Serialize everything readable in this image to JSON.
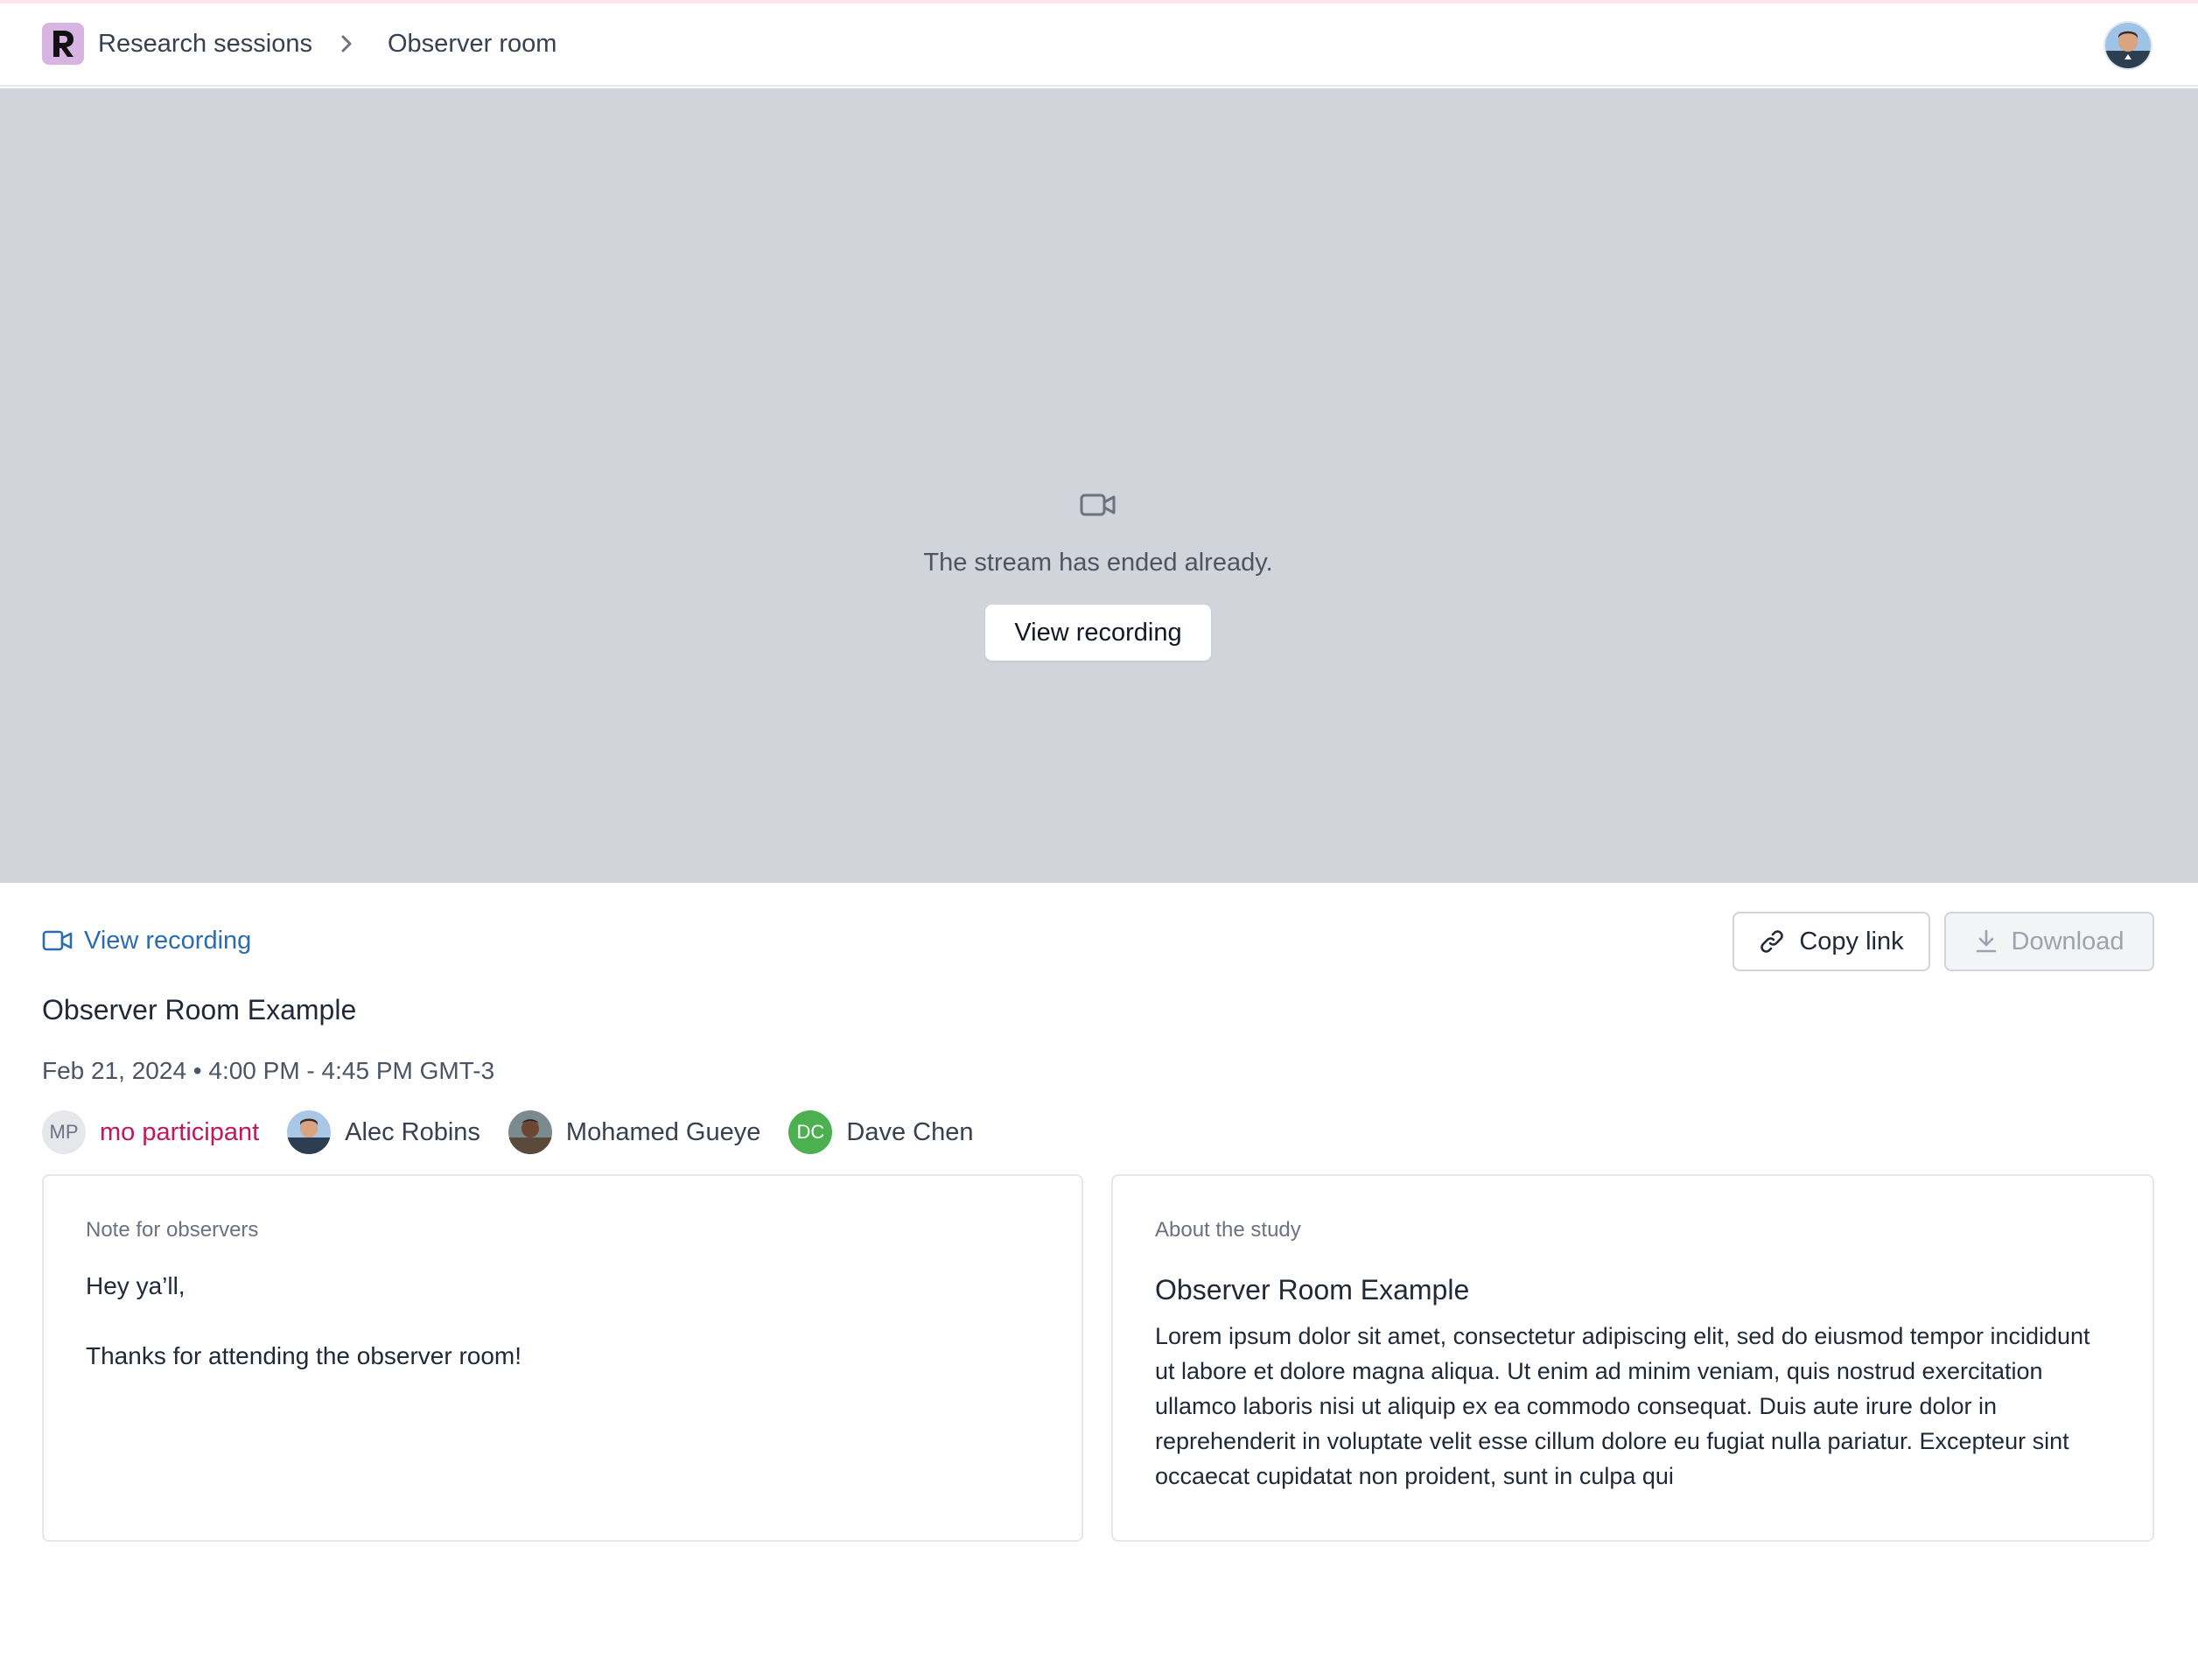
{
  "header": {
    "logo_letter": "R",
    "breadcrumb": [
      {
        "label": "Research sessions"
      },
      {
        "label": "Observer room"
      }
    ]
  },
  "stream": {
    "message": "The stream has ended already.",
    "button_label": "View recording"
  },
  "session": {
    "view_recording_link": "View recording",
    "copy_link_label": "Copy link",
    "download_label": "Download",
    "title": "Observer Room Example",
    "datetime": "Feb 21, 2024 • 4:00 PM - 4:45 PM GMT-3",
    "participants": [
      {
        "initials": "MP",
        "name": "mo participant",
        "highlight_color": "#c2185b"
      },
      {
        "name": "Alec Robins"
      },
      {
        "name": "Mohamed Gueye"
      },
      {
        "initials": "DC",
        "name": "Dave Chen",
        "avatar_color": "#4caf50"
      }
    ]
  },
  "note_card": {
    "label": "Note for observers",
    "lines": [
      "Hey ya’ll,",
      "Thanks for attending the observer room!"
    ]
  },
  "study_card": {
    "label": "About the study",
    "title": "Observer Room Example",
    "body": "Lorem ipsum dolor sit amet, consectetur adipiscing elit, sed do eiusmod tempor incididunt ut labore et dolore magna aliqua. Ut enim ad minim veniam, quis nostrud exercitation ullamco laboris nisi ut aliquip ex ea commodo consequat. Duis aute irure dolor in reprehenderit in voluptate velit esse cillum dolore eu fugiat nulla pariatur. Excepteur sint occaecat cupidatat non proident, sunt in culpa qui"
  },
  "colors": {
    "link": "#2b6cb0",
    "stream_bg": "#d1d5db",
    "logo_bg": "#d8b4e2"
  }
}
